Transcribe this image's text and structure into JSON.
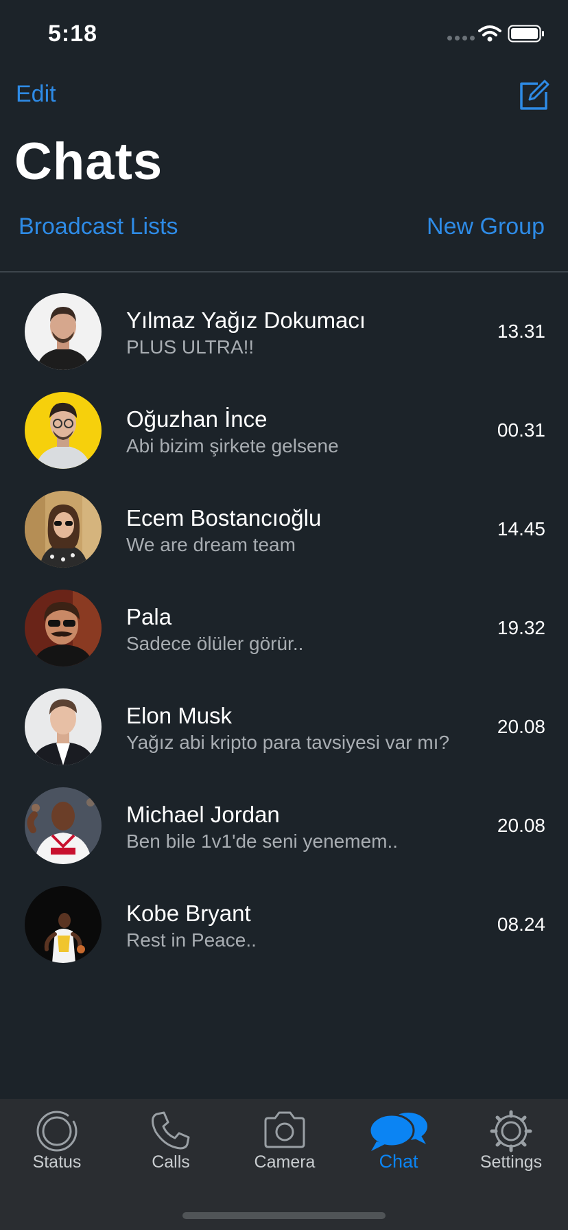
{
  "status_bar": {
    "time": "5:18"
  },
  "header": {
    "edit_label": "Edit",
    "title": "Chats",
    "broadcast_label": "Broadcast Lists",
    "new_group_label": "New Group",
    "compose_icon": "compose-icon"
  },
  "colors": {
    "background": "#1c2329",
    "accent": "#2e8be6",
    "tab_active": "#0b84f3",
    "tab_bar": "#2a2d31"
  },
  "chats": [
    {
      "name": "Yılmaz Yağız Dokumacı",
      "preview": "PLUS ULTRA!!",
      "time": "13.31",
      "avatar": "avatar-yilmaz"
    },
    {
      "name": "Oğuzhan İnce",
      "preview": "Abi bizim şirkete gelsene",
      "time": "00.31",
      "avatar": "avatar-oguzhan"
    },
    {
      "name": "Ecem Bostancıoğlu",
      "preview": "We are dream team",
      "time": "14.45",
      "avatar": "avatar-ecem"
    },
    {
      "name": "Pala",
      "preview": "Sadece ölüler görür..",
      "time": "19.32",
      "avatar": "avatar-pala"
    },
    {
      "name": "Elon Musk",
      "preview": "Yağız abi kripto para tavsiyesi var mı?",
      "time": "20.08",
      "avatar": "avatar-elon"
    },
    {
      "name": "Michael Jordan",
      "preview": "Ben bile 1v1'de seni yenemem..",
      "time": "20.08",
      "avatar": "avatar-jordan"
    },
    {
      "name": "Kobe Bryant",
      "preview": "Rest in Peace..",
      "time": "08.24",
      "avatar": "avatar-kobe"
    }
  ],
  "tabs": [
    {
      "label": "Status",
      "icon": "status-icon",
      "active": false
    },
    {
      "label": "Calls",
      "icon": "phone-icon",
      "active": false
    },
    {
      "label": "Camera",
      "icon": "camera-icon",
      "active": false
    },
    {
      "label": "Chat",
      "icon": "chat-bubbles-icon",
      "active": true
    },
    {
      "label": "Settings",
      "icon": "gear-icon",
      "active": false
    }
  ]
}
